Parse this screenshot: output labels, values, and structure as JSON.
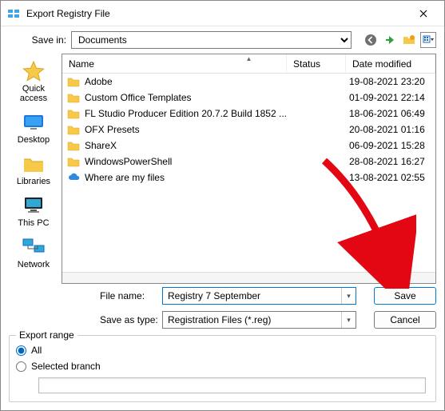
{
  "window": {
    "title": "Export Registry File"
  },
  "toolbar": {
    "savein_label": "Save in:",
    "savein_value": "Documents"
  },
  "columns": {
    "name": "Name",
    "status": "Status",
    "date": "Date modified"
  },
  "places": {
    "quick": "Quick access",
    "desktop": "Desktop",
    "libraries": "Libraries",
    "thispc": "This PC",
    "network": "Network"
  },
  "files": [
    {
      "name": "Adobe",
      "date": "19-08-2021 23:20",
      "type": "folder"
    },
    {
      "name": "Custom Office Templates",
      "date": "01-09-2021 22:14",
      "type": "folder"
    },
    {
      "name": "FL Studio Producer Edition 20.7.2 Build 1852 ...",
      "date": "18-06-2021 06:49",
      "type": "folder"
    },
    {
      "name": "OFX Presets",
      "date": "20-08-2021 01:16",
      "type": "folder"
    },
    {
      "name": "ShareX",
      "date": "06-09-2021 15:28",
      "type": "folder"
    },
    {
      "name": "WindowsPowerShell",
      "date": "28-08-2021 16:27",
      "type": "folder"
    },
    {
      "name": "Where are my files",
      "date": "13-08-2021 02:55",
      "type": "cloud"
    }
  ],
  "fields": {
    "filename_label": "File name:",
    "filename_value": "Registry 7 September",
    "saveastype_label": "Save as type:",
    "saveastype_value": "Registration Files (*.reg)"
  },
  "buttons": {
    "save": "Save",
    "cancel": "Cancel"
  },
  "export_range": {
    "legend": "Export range",
    "all": "All",
    "selected": "Selected branch",
    "branch_value": ""
  }
}
